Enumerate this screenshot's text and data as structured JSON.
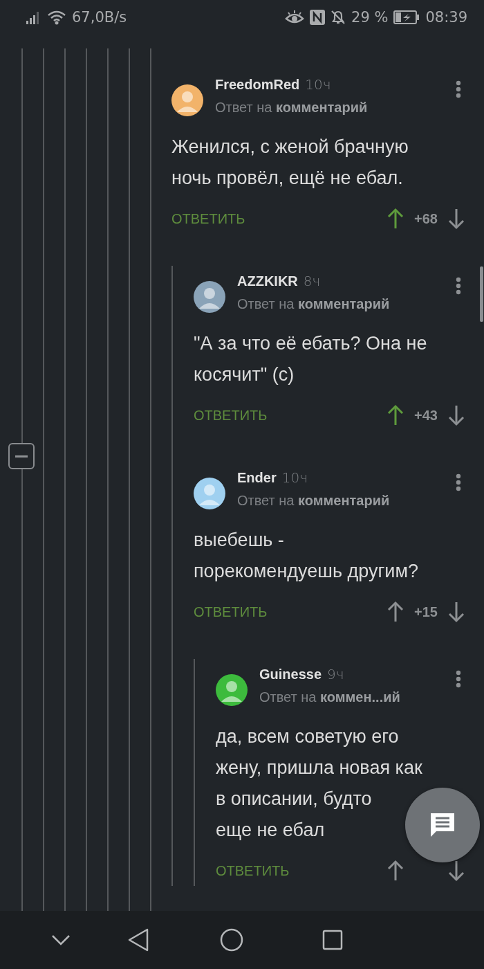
{
  "status_bar": {
    "net_speed": "67,0B/s",
    "battery": "29 %",
    "time": "08:39"
  },
  "comments": [
    {
      "author": "FreedomRed",
      "time": "10ч",
      "reply_prefix": "Ответ на",
      "reply_target": "комментарий",
      "color": "#f2b36a",
      "lines": [
        "Женился, с женой брачную",
        "ночь провёл, ещё не ебал."
      ],
      "reply_button": "ОТВЕТИТЬ",
      "score": "+68",
      "upvoted": true,
      "children": [
        {
          "author": "AZZKIKR",
          "time": "8ч",
          "reply_prefix": "Ответ на",
          "reply_target": "комментарий",
          "color": "#8aa3b8",
          "lines": [
            "\"А за что её ебать? Она не",
            "косячит\" (с)"
          ],
          "reply_button": "ОТВЕТИТЬ",
          "score": "+43",
          "upvoted": true
        },
        {
          "author": "Ender",
          "time": "10ч",
          "reply_prefix": "Ответ на",
          "reply_target": "комментарий",
          "color": "#9fd0f0",
          "lines": [
            "выебешь -",
            "порекомендуешь другим?"
          ],
          "reply_button": "ОТВЕТИТЬ",
          "score": "+15",
          "upvoted": false,
          "children": [
            {
              "author": "Guinesse",
              "time": "9ч",
              "reply_prefix": "Ответ на",
              "reply_target": "коммен...ий",
              "color": "#3dbb3d",
              "lines": [
                "да, всем советую его",
                "жену, пришла новая как",
                "в описании, будто",
                "еще не ебал"
              ],
              "reply_button": "ОТВЕТИТЬ",
              "upvoted": false
            }
          ]
        }
      ]
    }
  ]
}
